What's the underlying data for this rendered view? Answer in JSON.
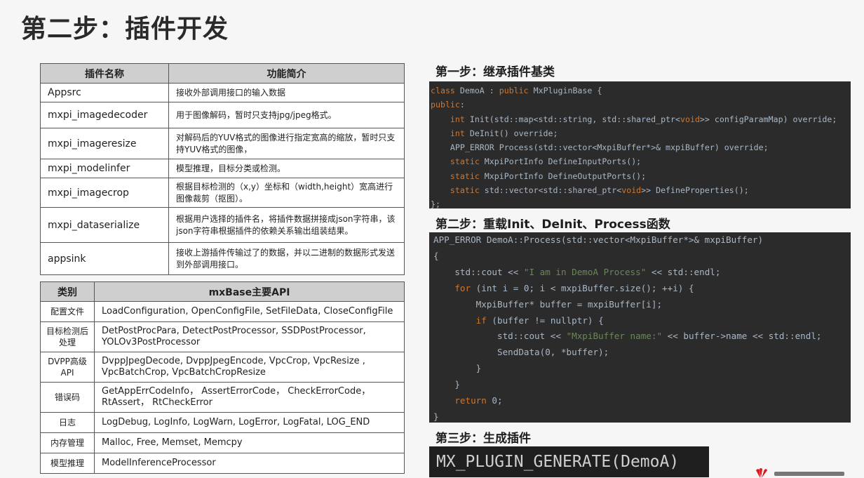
{
  "title": "第二步：插件开发",
  "plugin_table": {
    "headers": [
      "插件名称",
      "功能简介"
    ],
    "rows": [
      {
        "name": "Appsrc",
        "desc": "接收外部调用接口的输入数据"
      },
      {
        "name": "mxpi_imagedecoder",
        "desc": "用于图像解码，暂时只支持jpg/jpeg格式。"
      },
      {
        "name": "mxpi_imageresize",
        "desc": "对解码后的YUV格式的图像进行指定宽高的缩放，暂时只支持YUV格式的图像，"
      },
      {
        "name": "mxpi_modelinfer",
        "desc": "模型推理，目标分类或检测。"
      },
      {
        "name": "mxpi_imagecrop",
        "desc": "根据目标检测的（x,y）坐标和（width,height）宽高进行图像裁剪（抠图）。"
      },
      {
        "name": "mxpi_dataserialize",
        "desc": "根据用户选择的插件名，将插件数据拼接成json字符串，该json字符串根据插件的依赖关系输出组装结果。"
      },
      {
        "name": "appsink",
        "desc": "接收上游插件传输过了的数据，并以二进制的数据形式发送到外部调用接口。"
      }
    ]
  },
  "api_table": {
    "headers": [
      "类别",
      "mxBase主要API"
    ],
    "rows": [
      {
        "category": "配置文件",
        "apis": "LoadConfiguration, OpenConfigFile, SetFileData, CloseConfigFile"
      },
      {
        "category": "目标检测后处理",
        "apis": "DetPostProcPara, DetectPostProcessor, SSDPostProcessor, YOLOv3PostProcessor"
      },
      {
        "category": "DVPP高级API",
        "apis": "DvppJpegDecode, DvppJpegEncode, VpcCrop, VpcResize , VpcBatchCrop, VpcBatchCropResize"
      },
      {
        "category": "错误码",
        "apis": "GetAppErrCodeInfo， AssertErrorCode， CheckErrorCode， RtAssert， RtCheckError"
      },
      {
        "category": "日志",
        "apis": "LogDebug, LogInfo, LogWarn, LogError, LogFatal, LOG_END"
      },
      {
        "category": "内存管理",
        "apis": "Malloc, Free, Memset, Memcpy"
      },
      {
        "category": "模型推理",
        "apis": "ModelInferenceProcessor"
      }
    ]
  },
  "step1": {
    "title": "第一步：继承插件基类",
    "code": [
      {
        "kw": "class",
        "rest": " DemoA : ",
        "kw2": "public",
        "rest2": " MxPluginBase {"
      },
      {
        "kw": "public",
        "rest": ":",
        "kw2": "",
        "rest2": ""
      },
      {
        "kw": "    int",
        "rest": " Init(std::map<std::string, std::shared_ptr<",
        "kw2": "void",
        "rest2": ">> configParamMap) override;"
      },
      {
        "kw": "    int",
        "rest": " DeInit() override;",
        "kw2": "",
        "rest2": ""
      },
      {
        "kw": "",
        "rest": "    APP_ERROR Process(std::vector<MxpiBuffer*>& mxpiBuffer) override;",
        "kw2": "",
        "rest2": ""
      },
      {
        "kw": "    static",
        "rest": " MxpiPortInfo DefineInputPorts();",
        "kw2": "",
        "rest2": ""
      },
      {
        "kw": "    static",
        "rest": " MxpiPortInfo DefineOutputPorts();",
        "kw2": "",
        "rest2": ""
      },
      {
        "kw": "    static",
        "rest": " std::vector<std::shared_ptr<",
        "kw2": "void",
        "rest2": ">> DefineProperties();"
      },
      {
        "kw": "",
        "rest": "};",
        "kw2": "",
        "rest2": ""
      }
    ]
  },
  "step2": {
    "title": "第二步：重载Init、DeInit、Process函数",
    "code": [
      {
        "kw": "",
        "rest": "APP_ERROR DemoA::Process(std::vector<MxpiBuffer*>& mxpiBuffer)",
        "str": "",
        "tail": ""
      },
      {
        "kw": "",
        "rest": "{",
        "str": "",
        "tail": ""
      },
      {
        "kw": "",
        "rest": "    std::cout << ",
        "str": "\"I am in DemoA Process\"",
        "tail": " << std::endl;"
      },
      {
        "kw": "    for",
        "rest": " (",
        "str": "",
        "tail": "int i = 0; i < mxpiBuffer.size(); ++i) {"
      },
      {
        "kw": "",
        "rest": "        MxpiBuffer* buffer = mxpiBuffer[i];",
        "str": "",
        "tail": ""
      },
      {
        "kw": "        if",
        "rest": " (buffer != ",
        "str": "",
        "tail": "nullptr) {"
      },
      {
        "kw": "",
        "rest": "            std::cout << ",
        "str": "\"MxpiBuffer name:\"",
        "tail": " << buffer->name << std::endl;"
      },
      {
        "kw": "",
        "rest": "            SendData(0, *buffer);",
        "str": "",
        "tail": ""
      },
      {
        "kw": "",
        "rest": "        }",
        "str": "",
        "tail": ""
      },
      {
        "kw": "",
        "rest": "    }",
        "str": "",
        "tail": ""
      },
      {
        "kw": "    return",
        "rest": " 0;",
        "str": "",
        "tail": ""
      },
      {
        "kw": "",
        "rest": "}",
        "str": "",
        "tail": ""
      }
    ]
  },
  "step3": {
    "title": "第三步：生成插件",
    "code": "MX_PLUGIN_GENERATE(DemoA)"
  },
  "colors": {
    "code_bg": "#2b2b2b",
    "keyword": "#cc7832",
    "string": "#6a8759",
    "number": "#6897bb",
    "text": "#a9b7c6",
    "table_header": "#cfcfcf",
    "logo": "#e0161d"
  },
  "logo_icon": "huawei-logo-icon"
}
